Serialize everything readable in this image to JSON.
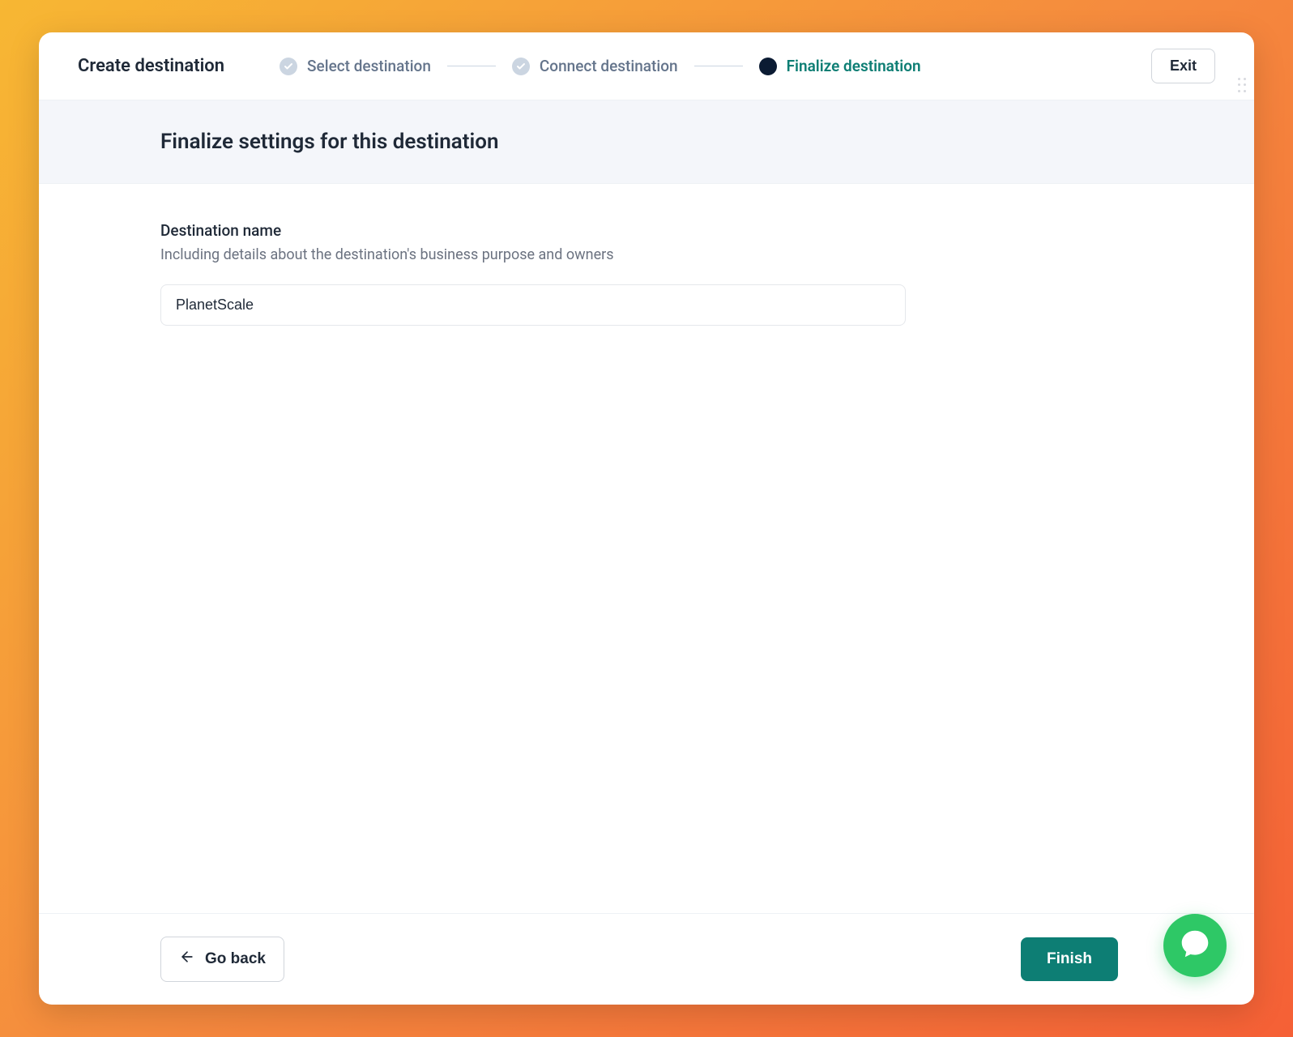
{
  "header": {
    "title": "Create destination",
    "exit_label": "Exit"
  },
  "stepper": {
    "step1_label": "Select destination",
    "step2_label": "Connect destination",
    "step3_label": "Finalize destination"
  },
  "subheader": {
    "heading": "Finalize settings for this destination"
  },
  "form": {
    "name_label": "Destination name",
    "name_description": "Including details about the destination's business purpose and owners",
    "name_value": "PlanetScale"
  },
  "footer": {
    "go_back_label": "Go back",
    "finish_label": "Finish"
  }
}
